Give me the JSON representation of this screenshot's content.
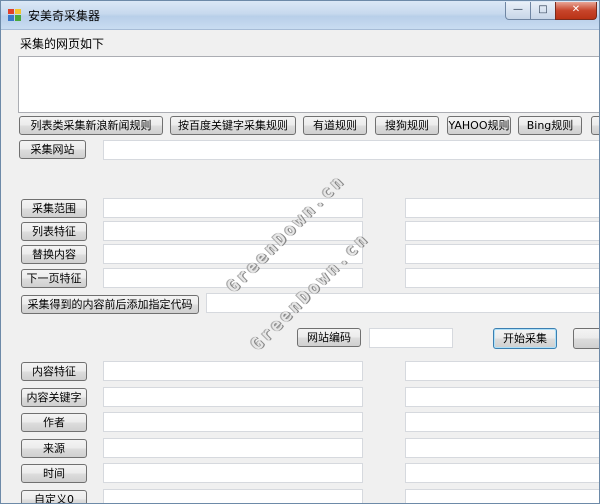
{
  "window": {
    "title": "安美奇采集器",
    "controls": {
      "minimize": "—",
      "maximize": "□",
      "close": "✕"
    }
  },
  "page_label": "采集的网页如下",
  "page_content": "",
  "rule_buttons": [
    "列表类采集新浪新闻规则",
    "按百度关键字采集规则",
    "有道规则",
    "搜狗规则",
    "YAHOO规则",
    "Bing规则"
  ],
  "site_button": "采集网站",
  "site_value": "",
  "field_buttons": {
    "range": "采集范围",
    "list_feature": "列表特征",
    "replace": "替换内容",
    "next_page": "下一页特征",
    "add_code": "采集得到的内容前后添加指定代码",
    "encoding": "网站编码",
    "start": "开始采集",
    "content_feature": "内容特征",
    "content_keyword": "内容关键字",
    "author": "作者",
    "source": "来源",
    "time": "时间",
    "custom": "自定义0"
  },
  "watermark": [
    "GreenDown.cn",
    "GreenDown.cn"
  ],
  "colors": {
    "window_bg": "#f0f0f0",
    "close_button": "#c7452b",
    "focus_border": "#3c7fb1"
  }
}
